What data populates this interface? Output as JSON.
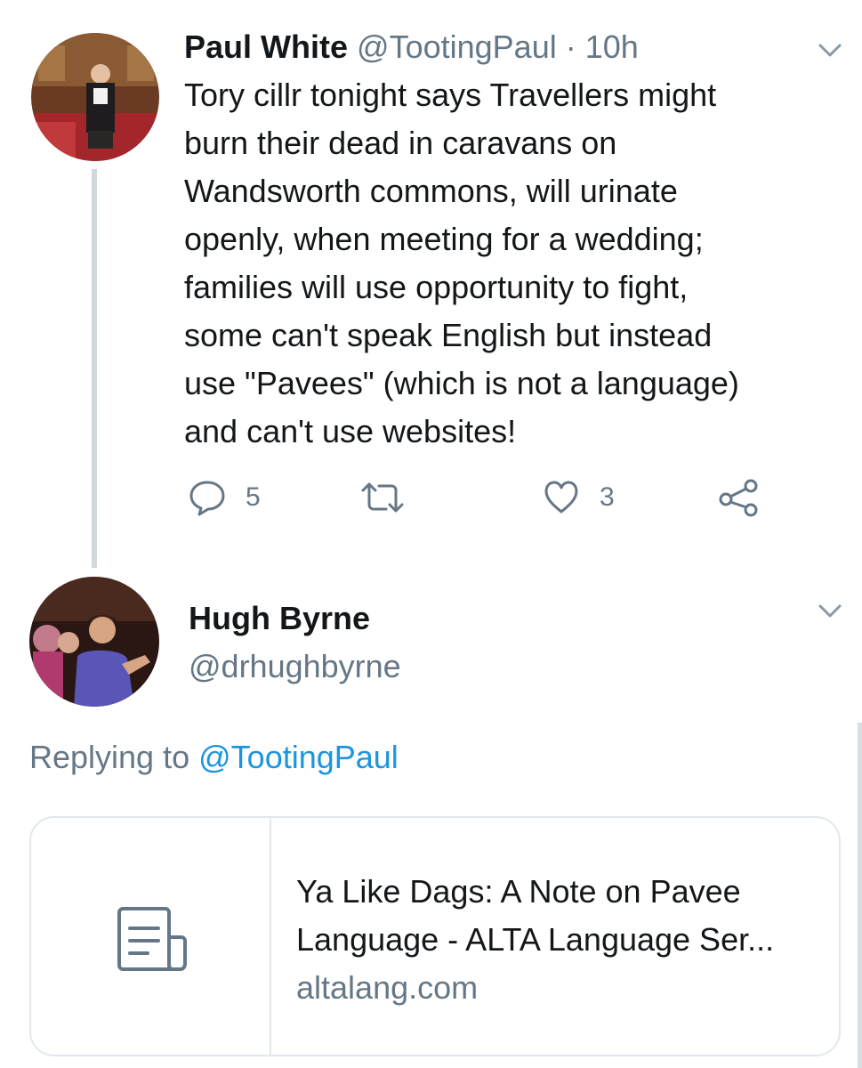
{
  "tweet": {
    "name": "Paul White",
    "handle": "@TootingPaul",
    "separator": "·",
    "time": "10h",
    "text_lines": [
      "Tory cillr tonight says Travellers might",
      "burn their dead in caravans on",
      "Wandsworth commons, will urinate",
      "openly, when meeting for a wedding;",
      "families will use opportunity to fight,",
      "some can't speak English but instead",
      "use \"Pavees\" (which is not a language)",
      "and can't use websites!"
    ],
    "reply_count": "5",
    "retweet_count": "",
    "like_count": "3",
    "menu_icon": "chevron-down-icon"
  },
  "reply": {
    "name": "Hugh Byrne",
    "handle": "@drhughbyrne",
    "replying_to_label": "Replying to",
    "replying_to_handle": "@TootingPaul",
    "menu_icon": "chevron-down-icon"
  },
  "card": {
    "title_lines": [
      "Ya Like Dags: A Note on Pavee",
      "Language - ALTA Language Ser..."
    ],
    "domain": "altalang.com",
    "icon": "article-icon"
  },
  "colors": {
    "text": "#14171a",
    "muted": "#657786",
    "link": "#1b95e0",
    "border": "#e1e8ed",
    "thread_line": "#cfd9de"
  }
}
